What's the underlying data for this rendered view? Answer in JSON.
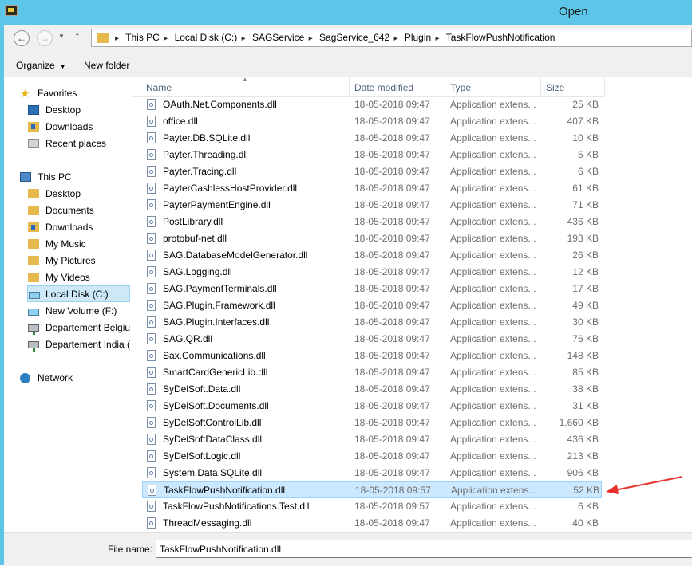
{
  "window": {
    "title": "Open"
  },
  "address": {
    "crumbs": [
      "This PC",
      "Local Disk (C:)",
      "SAGService",
      "SagService_642",
      "Plugin",
      "TaskFlowPushNotification"
    ]
  },
  "toolbar": {
    "organize_label": "Organize",
    "new_folder_label": "New folder"
  },
  "nav": {
    "favorites": {
      "label": "Favorites",
      "items": [
        "Desktop",
        "Downloads",
        "Recent places"
      ]
    },
    "this_pc": {
      "label": "This PC",
      "items": [
        "Desktop",
        "Documents",
        "Downloads",
        "My Music",
        "My Pictures",
        "My Videos",
        "Local Disk (C:)",
        "New Volume (F:)",
        "Departement Belgiu",
        "Departement India ("
      ]
    },
    "network": {
      "label": "Network"
    }
  },
  "columns": {
    "name": "Name",
    "date": "Date modified",
    "type": "Type",
    "size": "Size"
  },
  "files": [
    {
      "name": "OAuth.Net.Components.dll",
      "date": "18-05-2018 09:47",
      "type": "Application extens...",
      "size": "25 KB"
    },
    {
      "name": "office.dll",
      "date": "18-05-2018 09:47",
      "type": "Application extens...",
      "size": "407 KB"
    },
    {
      "name": "Payter.DB.SQLite.dll",
      "date": "18-05-2018 09:47",
      "type": "Application extens...",
      "size": "10 KB"
    },
    {
      "name": "Payter.Threading.dll",
      "date": "18-05-2018 09:47",
      "type": "Application extens...",
      "size": "5 KB"
    },
    {
      "name": "Payter.Tracing.dll",
      "date": "18-05-2018 09:47",
      "type": "Application extens...",
      "size": "6 KB"
    },
    {
      "name": "PayterCashlessHostProvider.dll",
      "date": "18-05-2018 09:47",
      "type": "Application extens...",
      "size": "61 KB"
    },
    {
      "name": "PayterPaymentEngine.dll",
      "date": "18-05-2018 09:47",
      "type": "Application extens...",
      "size": "71 KB"
    },
    {
      "name": "PostLibrary.dll",
      "date": "18-05-2018 09:47",
      "type": "Application extens...",
      "size": "436 KB"
    },
    {
      "name": "protobuf-net.dll",
      "date": "18-05-2018 09:47",
      "type": "Application extens...",
      "size": "193 KB"
    },
    {
      "name": "SAG.DatabaseModelGenerator.dll",
      "date": "18-05-2018 09:47",
      "type": "Application extens...",
      "size": "26 KB"
    },
    {
      "name": "SAG.Logging.dll",
      "date": "18-05-2018 09:47",
      "type": "Application extens...",
      "size": "12 KB"
    },
    {
      "name": "SAG.PaymentTerminals.dll",
      "date": "18-05-2018 09:47",
      "type": "Application extens...",
      "size": "17 KB"
    },
    {
      "name": "SAG.Plugin.Framework.dll",
      "date": "18-05-2018 09:47",
      "type": "Application extens...",
      "size": "49 KB"
    },
    {
      "name": "SAG.Plugin.Interfaces.dll",
      "date": "18-05-2018 09:47",
      "type": "Application extens...",
      "size": "30 KB"
    },
    {
      "name": "SAG.QR.dll",
      "date": "18-05-2018 09:47",
      "type": "Application extens...",
      "size": "76 KB"
    },
    {
      "name": "Sax.Communications.dll",
      "date": "18-05-2018 09:47",
      "type": "Application extens...",
      "size": "148 KB"
    },
    {
      "name": "SmartCardGenericLib.dll",
      "date": "18-05-2018 09:47",
      "type": "Application extens...",
      "size": "85 KB"
    },
    {
      "name": "SyDelSoft.Data.dll",
      "date": "18-05-2018 09:47",
      "type": "Application extens...",
      "size": "38 KB"
    },
    {
      "name": "SyDelSoft.Documents.dll",
      "date": "18-05-2018 09:47",
      "type": "Application extens...",
      "size": "31 KB"
    },
    {
      "name": "SyDelSoftControlLib.dll",
      "date": "18-05-2018 09:47",
      "type": "Application extens...",
      "size": "1,660 KB"
    },
    {
      "name": "SyDelSoftDataClass.dll",
      "date": "18-05-2018 09:47",
      "type": "Application extens...",
      "size": "436 KB"
    },
    {
      "name": "SyDelSoftLogic.dll",
      "date": "18-05-2018 09:47",
      "type": "Application extens...",
      "size": "213 KB"
    },
    {
      "name": "System.Data.SQLite.dll",
      "date": "18-05-2018 09:47",
      "type": "Application extens...",
      "size": "906 KB"
    },
    {
      "name": "TaskFlowPushNotification.dll",
      "date": "18-05-2018 09:57",
      "type": "Application extens...",
      "size": "52 KB",
      "selected": true
    },
    {
      "name": "TaskFlowPushNotifications.Test.dll",
      "date": "18-05-2018 09:57",
      "type": "Application extens...",
      "size": "6 KB"
    },
    {
      "name": "ThreadMessaging.dll",
      "date": "18-05-2018 09:47",
      "type": "Application extens...",
      "size": "40 KB"
    }
  ],
  "filename": {
    "label": "File name:",
    "value": "TaskFlowPushNotification.dll"
  },
  "colors": {
    "titlebar": "#5cc5e8",
    "selection": "#cce8ff",
    "annotation_arrow": "#e8312a"
  }
}
